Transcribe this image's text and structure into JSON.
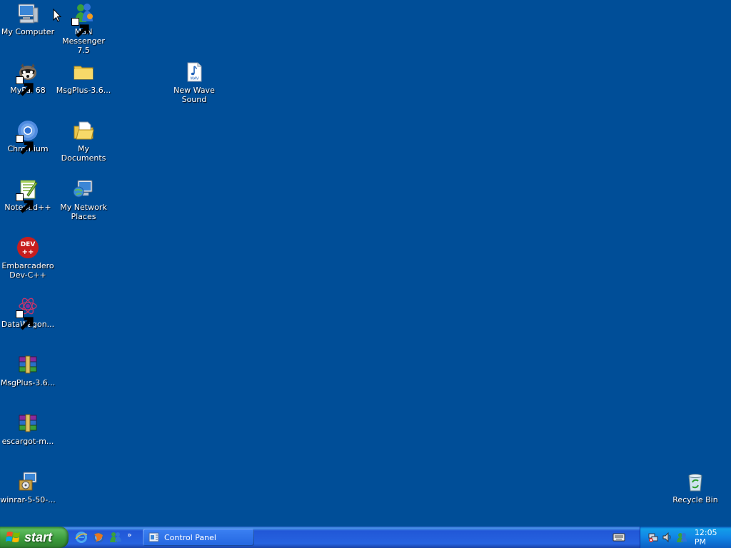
{
  "desktop": {
    "background_color": "#004E98",
    "icons": [
      {
        "label": "My Computer"
      },
      {
        "label": "MSN\nMessenger 7.5"
      },
      {
        "label": "MyPal 68"
      },
      {
        "label": "MsgPlus-3.6..."
      },
      {
        "label": "New Wave\nSound"
      },
      {
        "label": "Chromium"
      },
      {
        "label": "My Documents"
      },
      {
        "label": "Notepad++"
      },
      {
        "label": "My Network\nPlaces"
      },
      {
        "label": "Embarcadero\nDev-C++"
      },
      {
        "label": "DataWagon..."
      },
      {
        "label": "MsgPlus-3.6..."
      },
      {
        "label": "escargot-m..."
      },
      {
        "label": "winrar-5-50-..."
      },
      {
        "label": "Recycle Bin"
      }
    ]
  },
  "taskbar": {
    "start_label": "start",
    "quick_launch": [
      "ie-icon",
      "firefox-icon",
      "msn-icon"
    ],
    "quick_launch_more": "»",
    "tasks": [
      {
        "label": "Control Panel",
        "icon": "control-panel-icon"
      }
    ],
    "tray_icons": [
      "network-disconnected-icon",
      "volume-icon",
      "msn-tray-icon"
    ],
    "clock": "12:05 PM"
  }
}
